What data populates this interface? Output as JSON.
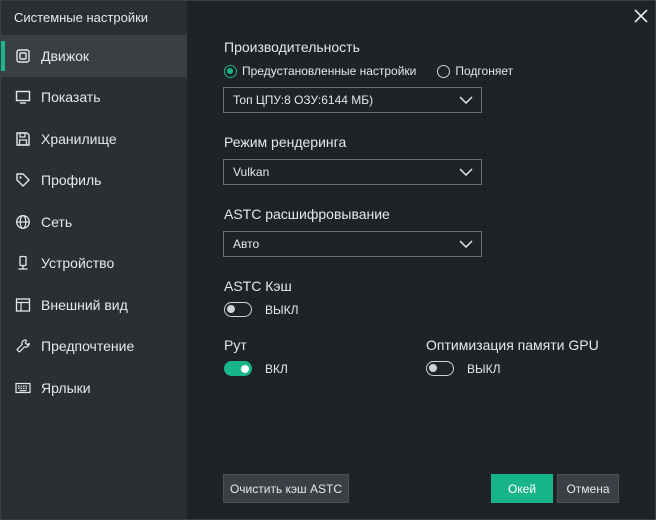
{
  "window": {
    "title": "Системные настройки"
  },
  "sidebar": {
    "items": [
      {
        "label": "Движок",
        "icon": "engine-icon",
        "active": true
      },
      {
        "label": "Показать",
        "icon": "display-icon"
      },
      {
        "label": "Хранилище",
        "icon": "storage-icon"
      },
      {
        "label": "Профиль",
        "icon": "tag-icon"
      },
      {
        "label": "Сеть",
        "icon": "globe-icon"
      },
      {
        "label": "Устройство",
        "icon": "device-icon"
      },
      {
        "label": "Внешний вид",
        "icon": "appearance-icon"
      },
      {
        "label": "Предпочтение",
        "icon": "wrench-icon"
      },
      {
        "label": "Ярлыки",
        "icon": "keyboard-icon"
      }
    ]
  },
  "performance": {
    "label": "Производительность",
    "options": [
      "Предустановленные настройки",
      "Подгоняет"
    ],
    "selected_option": "Предустановленные настройки",
    "preset_value": "Топ ЦПУ:8 ОЗУ:6144 МБ)"
  },
  "rendering": {
    "label": "Режим рендеринга",
    "value": "Vulkan"
  },
  "astc_decode": {
    "label": "ASTC расшифровывание",
    "value": "Авто"
  },
  "astc_cache": {
    "label": "ASTC Кэш",
    "state": "ВЫКЛ"
  },
  "root": {
    "label": "Рут",
    "state": "ВКЛ"
  },
  "gpu_mem": {
    "label": "Оптимизация памяти GPU",
    "state": "ВЫКЛ"
  },
  "buttons": {
    "clear_cache": "Очистить кэш ASTC",
    "ok": "Окей",
    "cancel": "Отмена"
  },
  "colors": {
    "accent": "#19b58a",
    "sidebar_bg": "#2b2f33",
    "content_bg": "#1f2226"
  }
}
